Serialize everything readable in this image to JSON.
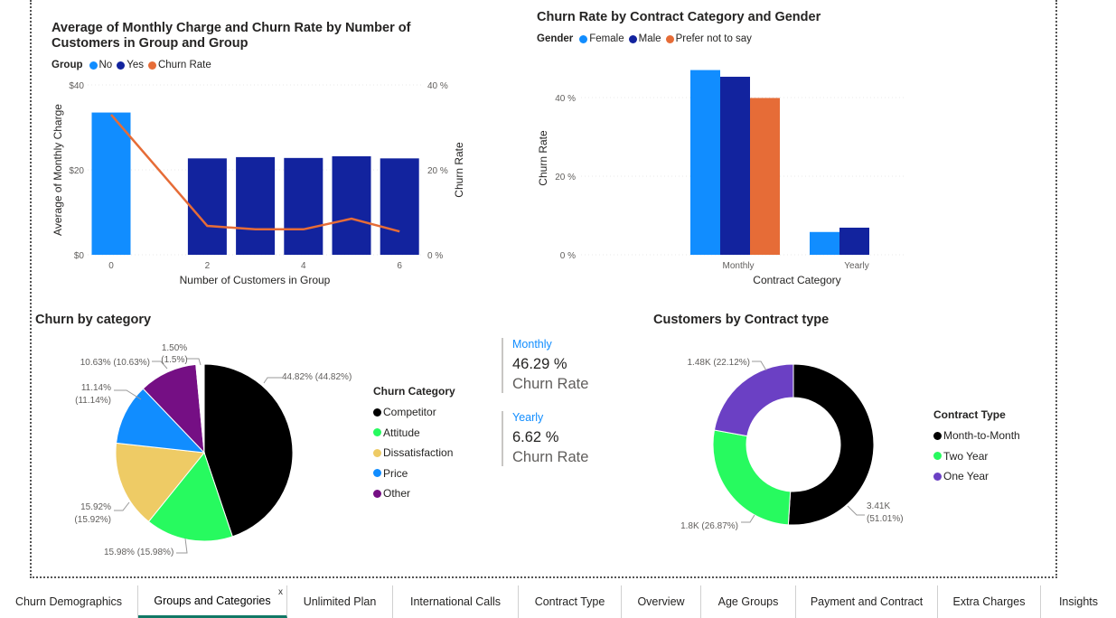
{
  "colors": {
    "light_blue": "#118dff",
    "dark_blue": "#12239e",
    "orange": "#e66c37",
    "black": "#000000",
    "green": "#27fa5f",
    "yellow": "#eecb65",
    "purple": "#6b40c4",
    "mauve": "#750f84",
    "tab_accent": "#117865"
  },
  "chart1": {
    "title": "Average of Monthly Charge and Churn Rate by Number of Customers in Group and Group",
    "legend_title": "Group",
    "legend_items": [
      {
        "label": "No",
        "color": "#118dff"
      },
      {
        "label": "Yes",
        "color": "#12239e"
      },
      {
        "label": "Churn Rate",
        "color": "#e66c37"
      }
    ],
    "xlabel": "Number of Customers in Group",
    "ylabel_left": "Average of Monthly Charge",
    "ylabel_right": "Churn Rate",
    "y_ticks_left": [
      "$0",
      "$20",
      "$40"
    ],
    "y_ticks_right": [
      "0 %",
      "20 %",
      "40 %"
    ],
    "x_ticks": [
      "0",
      "2",
      "4",
      "6"
    ]
  },
  "chart2": {
    "title": "Churn Rate by Contract Category and Gender",
    "legend_title": "Gender",
    "legend_items": [
      {
        "label": "Female",
        "color": "#118dff"
      },
      {
        "label": "Male",
        "color": "#12239e"
      },
      {
        "label": "Prefer not to say",
        "color": "#e66c37"
      }
    ],
    "xlabel": "Contract Category",
    "ylabel": "Churn Rate",
    "y_ticks": [
      "0 %",
      "20 %",
      "40 %"
    ],
    "categories": [
      "Monthly",
      "Yearly"
    ]
  },
  "chart3": {
    "title": "Churn by category",
    "legend_title": "Churn Category",
    "legend_items": [
      {
        "label": "Competitor",
        "color": "#000000"
      },
      {
        "label": "Attitude",
        "color": "#27fa5f"
      },
      {
        "label": "Dissatisfaction",
        "color": "#eecb65"
      },
      {
        "label": "Price",
        "color": "#118dff"
      },
      {
        "label": "Other",
        "color": "#750f84"
      }
    ],
    "labels": {
      "competitor": "44.82% (44.82%)",
      "attitude": "15.98% (15.98%)",
      "dissatisfaction_1": "15.92%",
      "dissatisfaction_2": "(15.92%)",
      "price_1": "11.14%",
      "price_2": "(11.14%)",
      "other": "10.63% (10.63%)",
      "misc_1": "1.50%",
      "misc_2": "(1.5%)"
    }
  },
  "cards": [
    {
      "period": "Monthly",
      "value": "46.29 %",
      "label": "Churn Rate"
    },
    {
      "period": "Yearly",
      "value": "6.62 %",
      "label": "Churn Rate"
    }
  ],
  "chart4": {
    "title": "Customers by Contract type",
    "legend_title": "Contract Type",
    "legend_items": [
      {
        "label": "Month-to-Month",
        "color": "#000000"
      },
      {
        "label": "Two Year",
        "color": "#27fa5f"
      },
      {
        "label": "One Year",
        "color": "#6b40c4"
      }
    ],
    "labels": {
      "month_1": "3.41K",
      "month_2": "(51.01%)",
      "two_year": "1.8K (26.87%)",
      "one_year": "1.48K (22.12%)"
    }
  },
  "chart_data": [
    {
      "type": "bar",
      "title": "Average of Monthly Charge and Churn Rate by Number of Customers in Group and Group",
      "xlabel": "Number of Customers in Group",
      "ylabel": "Average of Monthly Charge",
      "y2label": "Churn Rate",
      "x": [
        0,
        2,
        3,
        4,
        5,
        6
      ],
      "series": [
        {
          "name": "No",
          "kind": "bar",
          "values": [
            33.5,
            null,
            null,
            null,
            null,
            null
          ]
        },
        {
          "name": "Yes",
          "kind": "bar",
          "values": [
            null,
            22.7,
            23,
            22.8,
            23.2,
            22.7
          ]
        },
        {
          "name": "Churn Rate",
          "kind": "line",
          "axis": "right",
          "values": [
            33,
            6.8,
            6,
            6,
            8.5,
            5.5
          ]
        }
      ],
      "ylim": [
        0,
        40
      ],
      "y2lim": [
        0,
        40
      ]
    },
    {
      "type": "bar",
      "title": "Churn Rate by Contract Category and Gender",
      "xlabel": "Contract Category",
      "ylabel": "Churn Rate",
      "categories": [
        "Monthly",
        "Yearly"
      ],
      "series": [
        {
          "name": "Female",
          "values": [
            47,
            5.8
          ]
        },
        {
          "name": "Male",
          "values": [
            45.3,
            6.9
          ]
        },
        {
          "name": "Prefer not to say",
          "values": [
            39.9,
            null
          ]
        }
      ],
      "ylim": [
        0,
        50
      ]
    },
    {
      "type": "pie",
      "title": "Churn by category",
      "categories": [
        "Competitor",
        "Attitude",
        "Dissatisfaction",
        "Price",
        "Other",
        "Other (1.50%)"
      ],
      "values": [
        44.82,
        15.98,
        15.92,
        11.14,
        10.63,
        1.5
      ]
    },
    {
      "type": "pie",
      "title": "Customers by Contract type",
      "categories": [
        "Month-to-Month",
        "Two Year",
        "One Year"
      ],
      "values": [
        51.01,
        26.87,
        22.12
      ]
    }
  ],
  "tabs": [
    {
      "label": "Churn Demographics",
      "active": false
    },
    {
      "label": "Groups and Categories",
      "active": true
    },
    {
      "label": "Unlimited Plan",
      "active": false
    },
    {
      "label": "International Calls",
      "active": false
    },
    {
      "label": "Contract Type",
      "active": false
    },
    {
      "label": "Overview",
      "active": false
    },
    {
      "label": "Age Groups",
      "active": false
    },
    {
      "label": "Payment and Contract",
      "active": false
    },
    {
      "label": "Extra Charges",
      "active": false
    },
    {
      "label": "Insights",
      "active": false
    }
  ],
  "tab_close_icon": "x"
}
